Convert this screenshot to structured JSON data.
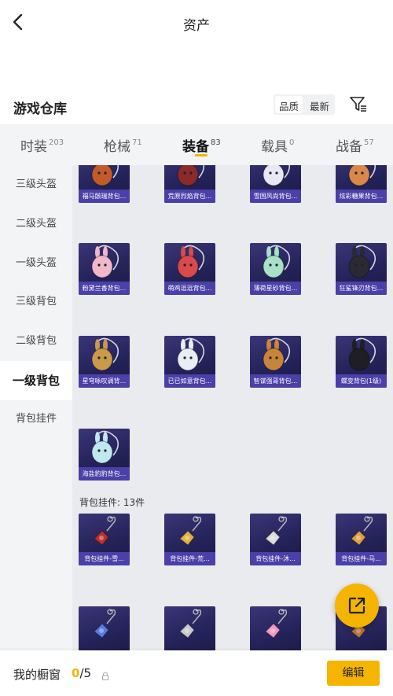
{
  "header": {
    "title": "资产"
  },
  "section": {
    "title": "游戏仓库",
    "sort_options": [
      "品质",
      "最新"
    ]
  },
  "tabs": [
    {
      "label": "时装",
      "count": "203"
    },
    {
      "label": "枪械",
      "count": "71"
    },
    {
      "label": "装备",
      "count": "83"
    },
    {
      "label": "载具",
      "count": "0"
    },
    {
      "label": "战备",
      "count": "57"
    }
  ],
  "sidebar": [
    {
      "label": "三级头盔"
    },
    {
      "label": "二级头盔"
    },
    {
      "label": "一级头盔"
    },
    {
      "label": "三级背包"
    },
    {
      "label": "二级背包"
    },
    {
      "label": "一级背包"
    },
    {
      "label": "背包挂件"
    }
  ],
  "grid": {
    "backpacks": [
      {
        "name": "福马骸瑞背包...",
        "art": "horse-bag",
        "color": "#c25a2a"
      },
      {
        "name": "荒原烈焰背包...",
        "art": "flame-bag",
        "color": "#8a2a2a"
      },
      {
        "name": "雪国风尚背包...",
        "art": "snow-bag",
        "color": "#e8e8f4"
      },
      {
        "name": "炫彩糖果背包...",
        "art": "donut-bag",
        "color": "#d9884a"
      },
      {
        "name": "粉黛兰香背包...",
        "art": "bunny-bag",
        "color": "#f0b8c8"
      },
      {
        "name": "萌鸡逗逗背包...",
        "art": "egg-bag",
        "color": "#d94a4a"
      },
      {
        "name": "薄荷星砂背包...",
        "art": "mint-bag",
        "color": "#a8e0c8"
      },
      {
        "name": "狂鲨锋刃背包...",
        "art": "shark-bag",
        "color": "#2a2a30"
      },
      {
        "name": "星穹咏叹调背...",
        "art": "star-bag",
        "color": "#c89a4a"
      },
      {
        "name": "已已如意背包...",
        "art": "rabbit-bag",
        "color": "#e8eef4"
      },
      {
        "name": "智谋强哥背包...",
        "art": "face-bag",
        "color": "#c8843a"
      },
      {
        "name": "蝶变背包(1级)",
        "art": "butterfly-bag",
        "color": "#1e1e24"
      },
      {
        "name": "海盐豹豹背包...",
        "art": "seal-bag",
        "color": "#bfe8f0"
      }
    ],
    "charm_group_label": "背包挂件: 13件",
    "charms": [
      {
        "name": "背包挂件-雪...",
        "art": "red-bell",
        "color": "#c0302a"
      },
      {
        "name": "背包挂件-荒...",
        "art": "gold-star",
        "color": "#e0b040"
      },
      {
        "name": "背包挂件-沐...",
        "art": "cat-charm",
        "color": "#dcdcdc"
      },
      {
        "name": "背包挂件-马...",
        "art": "horse-charm",
        "color": "#e0a040"
      },
      {
        "name": "",
        "art": "blue-ring",
        "color": "#5a7ae0"
      },
      {
        "name": "",
        "art": "silver-wing",
        "color": "#c8c8d0"
      },
      {
        "name": "",
        "art": "pink-bow",
        "color": "#f09ac0"
      },
      {
        "name": "",
        "art": "bronze-blade",
        "color": "#c0783a"
      }
    ]
  },
  "bottom": {
    "label": "我的橱窗",
    "count_current": "0",
    "count_total": "/5",
    "edit_label": "编辑"
  },
  "colors": {
    "accent": "#f5b400",
    "card_label": "#4b3fa8"
  }
}
